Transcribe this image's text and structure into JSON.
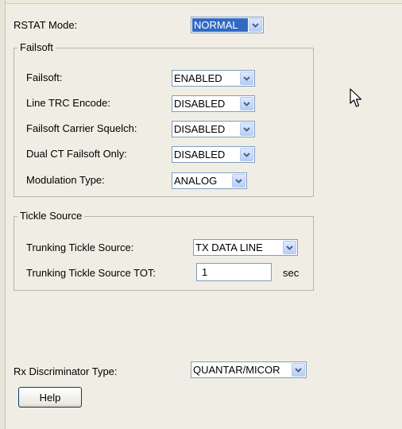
{
  "rstat_mode": {
    "label": "RSTAT Mode:",
    "value": "NORMAL"
  },
  "failsoft_group": {
    "legend": "Failsoft",
    "rows": [
      {
        "label": "Failsoft:",
        "value": "ENABLED"
      },
      {
        "label": "Line TRC Encode:",
        "value": "DISABLED"
      },
      {
        "label": "Failsoft Carrier Squelch:",
        "value": "DISABLED"
      },
      {
        "label": "Dual CT Failsoft Only:",
        "value": "DISABLED"
      },
      {
        "label": "Modulation Type:",
        "value": "ANALOG"
      }
    ]
  },
  "tickle_group": {
    "legend": "Tickle Source",
    "source_label": "Trunking Tickle Source:",
    "source_value": "TX DATA LINE",
    "tot_label": "Trunking Tickle Source TOT:",
    "tot_value": "1",
    "tot_unit": "sec"
  },
  "rx_discriminator": {
    "label": "Rx Discriminator Type:",
    "value": "QUANTAR/MICOR"
  },
  "help_button": "Help",
  "colors": {
    "select_border": "#7f9db9",
    "focus_highlight": "#316ac5",
    "panel_bg": "#f0eee4"
  },
  "icons": {
    "dropdown": "chevron-down-icon",
    "cursor": "mouse-cursor-icon"
  }
}
